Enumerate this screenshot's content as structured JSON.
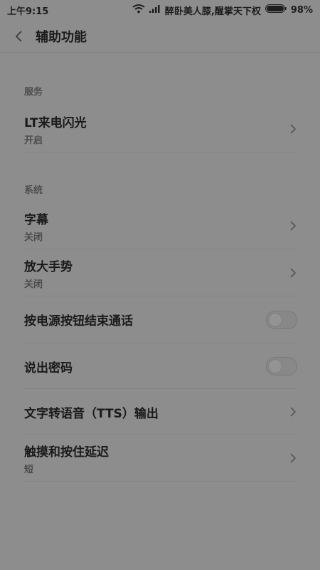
{
  "status": {
    "time": "上午9:15",
    "carrier_text": "醉卧美人膝,醒掌天下权",
    "battery": "98%"
  },
  "header": {
    "title": "辅助功能"
  },
  "sections": {
    "service": "服务",
    "system": "系统"
  },
  "rows": {
    "lt_flash": {
      "title": "LT来电闪光",
      "sub": "开启"
    },
    "subtitles": {
      "title": "字幕",
      "sub": "关闭"
    },
    "zoom_gesture": {
      "title": "放大手势",
      "sub": "关闭"
    },
    "power_end_call": {
      "title": "按电源按钮结束通话"
    },
    "speak_password": {
      "title": "说出密码"
    },
    "tts": {
      "title": "文字转语音（TTS）输出"
    },
    "touch_delay": {
      "title": "触摸和按住延迟",
      "sub": "短"
    }
  },
  "icons": [
    "wifi-icon",
    "signal-icon",
    "battery-icon",
    "back-icon",
    "chevron-right-icon"
  ],
  "colors": {
    "background": "#8d8d8d",
    "text_primary": "#1a1a1a",
    "text_secondary": "#4c4c4c"
  }
}
